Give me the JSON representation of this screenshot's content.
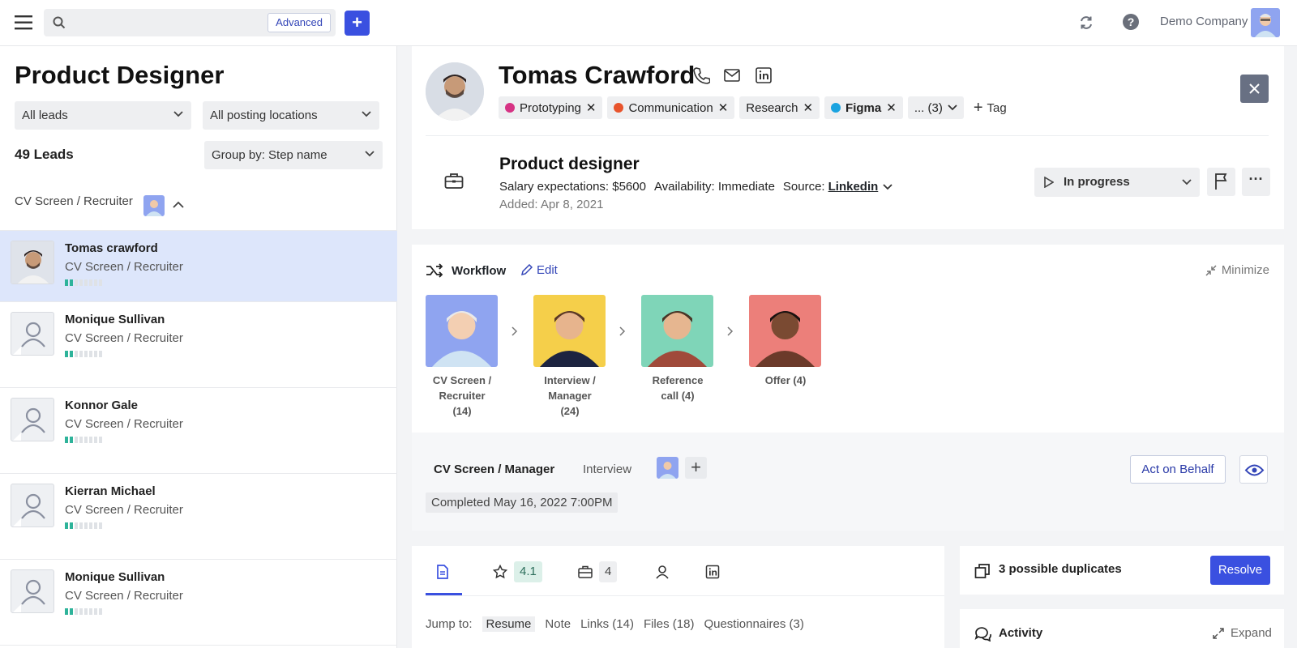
{
  "topbar": {
    "search_placeholder": "",
    "advanced_label": "Advanced",
    "add_label": "+",
    "company": "Demo Company"
  },
  "left": {
    "job_title": "Product Designer",
    "filter_leads": "All leads",
    "filter_locations": "All posting locations",
    "leads_count": "49 Leads",
    "group_by": "Group by: Step name",
    "group_header": "CV Screen / Recruiter",
    "leads": [
      {
        "name": "Tomas crawford",
        "step": "CV Screen / Recruiter",
        "progress": 2,
        "photo": true
      },
      {
        "name": "Monique Sullivan",
        "step": "CV Screen / Recruiter",
        "progress": 2,
        "photo": false
      },
      {
        "name": "Konnor Gale",
        "step": "CV Screen / Recruiter",
        "progress": 2,
        "photo": false
      },
      {
        "name": "Kierran Michael",
        "step": "CV Screen / Recruiter",
        "progress": 2,
        "photo": false
      },
      {
        "name": "Monique Sullivan",
        "step": "CV Screen / Recruiter",
        "progress": 2,
        "photo": false
      }
    ]
  },
  "candidate": {
    "name": "Tomas Crawford",
    "tags": [
      {
        "label": "Prototyping",
        "color": "#d63384"
      },
      {
        "label": "Communication",
        "color": "#e8542c"
      },
      {
        "label": "Research",
        "color": ""
      },
      {
        "label": "Figma",
        "color": "#1aa3e0"
      }
    ],
    "more_tags": "... (3)",
    "add_tag": "Tag",
    "position_title": "Product designer",
    "salary": "Salary expectations: $5600",
    "availability": "Availability: Immediate",
    "source_label": "Source:",
    "source_value": "Linkedin",
    "added": "Added: Apr 8, 2021",
    "status": "In progress",
    "more": "···"
  },
  "workflow": {
    "title": "Workflow",
    "edit": "Edit",
    "minimize": "Minimize",
    "stages": [
      {
        "line1": "CV Screen /",
        "line2": "Recruiter",
        "line3": "(14)",
        "bg": "#8fa4f0"
      },
      {
        "line1": "Interview /",
        "line2": "Manager",
        "line3": "(24)",
        "bg": "#f5cf4a"
      },
      {
        "line1": "Reference",
        "line2": "call (4)",
        "line3": "",
        "bg": "#7fd5b8"
      },
      {
        "line1": "Offer (4)",
        "line2": "",
        "line3": "",
        "bg": "#ec7f7a"
      }
    ],
    "tab_active": "CV Screen / Manager",
    "tab_other": "Interview",
    "completed": "Completed May 16, 2022 7:00PM",
    "act_on_behalf": "Act on Behalf"
  },
  "tabs": {
    "rating": "4.1",
    "jobs_count": "4",
    "jump_to": "Jump to:",
    "jump_items": [
      "Resume",
      "Note",
      "Links (14)",
      "Files (18)",
      "Questionnaires (3)"
    ]
  },
  "duplicates": {
    "text": "3 possible duplicates",
    "resolve": "Resolve"
  },
  "activity": {
    "title": "Activity",
    "expand": "Expand"
  }
}
